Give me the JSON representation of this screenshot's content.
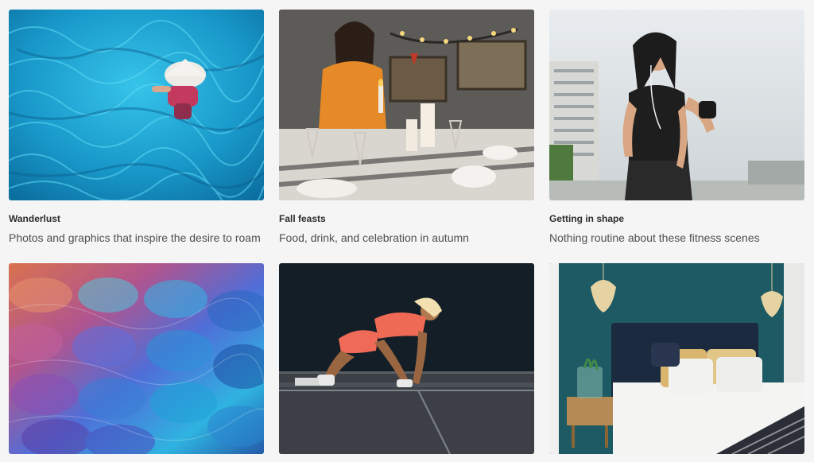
{
  "collections": [
    {
      "title": "Wanderlust",
      "description": "Photos and graphics that inspire the desire to roam",
      "image": "woman-in-turquoise-fabric"
    },
    {
      "title": "Fall feasts",
      "description": "Food, drink, and celebration in autumn",
      "image": "candlelit-dinner-table"
    },
    {
      "title": "Getting in shape",
      "description": "Nothing routine about these fitness scenes",
      "image": "woman-runner-with-earphones"
    },
    {
      "image": "colorful-feathers"
    },
    {
      "image": "sprinter-at-starting-line"
    },
    {
      "image": "teal-bedroom"
    }
  ],
  "colors": {
    "background": "#f5f5f5",
    "title": "#2c2c2c",
    "description": "#505050"
  }
}
